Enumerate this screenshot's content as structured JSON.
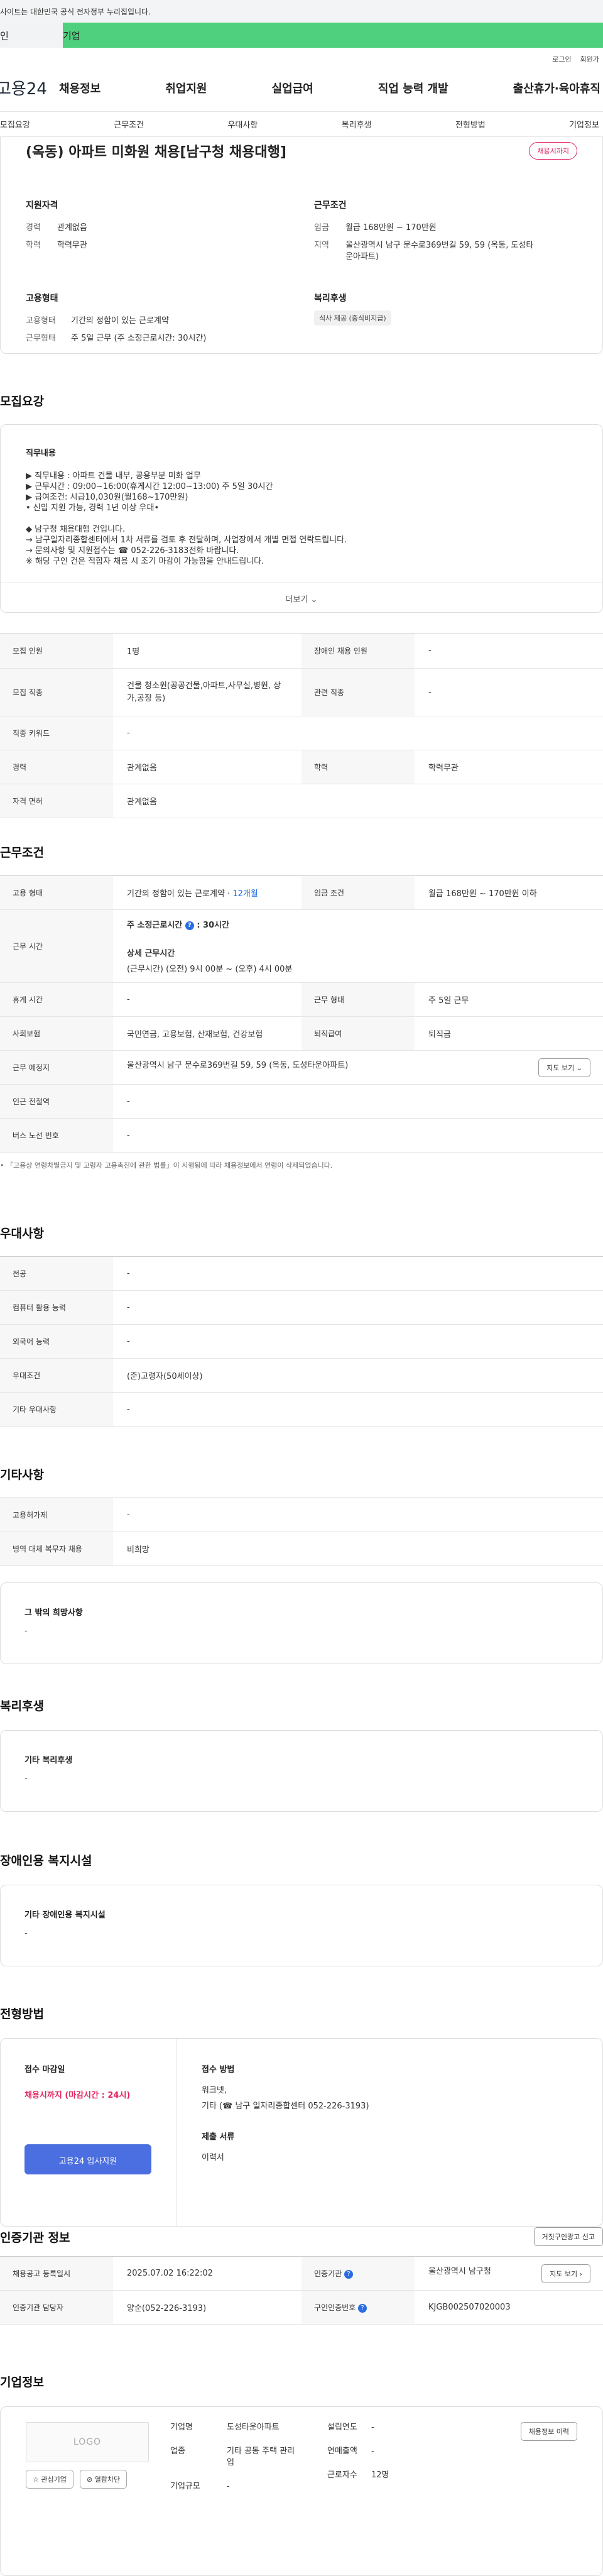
{
  "banner": {
    "text": "사이트는 대한민국 공식 전자정부 누리집입니다."
  },
  "tabs": {
    "personal": "인",
    "company": "기업"
  },
  "util": {
    "login": "로그인",
    "signup": "회원가"
  },
  "gnb": {
    "logo": "고용24",
    "items": [
      "채용정보",
      "취업지원",
      "실업급여",
      "직업 능력 개발",
      "출산휴가·육아휴직"
    ]
  },
  "subnav": {
    "items": [
      "모집요강",
      "근무조건",
      "우대사항",
      "복리후생",
      "전형방법",
      "기업정보"
    ]
  },
  "job": {
    "title": "(옥동) 아파트 미화원 채용[남구청 채용대행]",
    "badge": "채용시까지"
  },
  "summary": {
    "qual": {
      "title": "지원자격",
      "rows": [
        {
          "k": "경력",
          "v": "관계없음"
        },
        {
          "k": "학력",
          "v": "학력무관"
        }
      ]
    },
    "cond": {
      "title": "근무조건",
      "rows": [
        {
          "k": "임금",
          "v": "월급 168만원 ~ 170만원"
        },
        {
          "k": "지역",
          "v": "울산광역시 남구 문수로369번길 59, 59 (옥동, 도성타운아파트)"
        }
      ]
    },
    "emp": {
      "title": "고용형태",
      "rows": [
        {
          "k": "고용형태",
          "v": "기간의 정함이 있는 근로계약"
        },
        {
          "k": "근무형태",
          "v": "주 5일 근무 (주 소정근로시간: 30시간)"
        }
      ]
    },
    "welfare": {
      "title": "복리후생",
      "chip": "식사 제공 (중식비지급)"
    }
  },
  "recruit": {
    "section": "모집요강",
    "detail_heading": "직무내용",
    "detail_lines": [
      "▶ 직무내용 : 아파트 건물 내부, 공용부분 미화 업무",
      "▶ 근무시간 : 09:00~16:00(휴게시간 12:00~13:00) 주 5일 30시간",
      "▶ 급여조건: 시급10,030원(월168~170만원)",
      "• 신입 지원 가능, 경력 1년 이상 우대•",
      "",
      "◆ 남구청 채용대행 건입니다.",
      "→ 남구일자리종합센터에서 1차 서류를 검토 후 전달하며, 사업장에서 개별 면접 연락드립니다.",
      "→ 문의사항 및 지원접수는 ☎ 052-226-3183전화 바랍니다.",
      "※ 해당 구인 건은 적합자 채용 시 조기 마감이 가능함을 안내드립니다."
    ],
    "more": "더보기 ⌄",
    "rows": [
      {
        "k1": "모집 인원",
        "v1": "1명",
        "k2": "장애인 채용 인원",
        "v2": "-"
      },
      {
        "k1": "모집 직종",
        "v1": "건물 청소원(공공건물,아파트,사무실,병원, 상가,공장 등)",
        "k2": "관련 직종",
        "v2": "-"
      },
      {
        "k1": "직종 키워드",
        "v1": "-"
      },
      {
        "k1": "경력",
        "v1": "관계없음",
        "k2": "학력",
        "v2": "학력무관"
      },
      {
        "k1": "자격 면허",
        "v1": "관계없음"
      }
    ]
  },
  "conditions": {
    "section": "근무조건",
    "emp_type_k": "고용 형태",
    "emp_type_v": "기간의 정함이 있는 근로계약 · ",
    "emp_type_months": "12개월",
    "wage_k": "임금 조건",
    "wage_v": "월급 168만원 ~ 170만원 이하",
    "hours_k": "근무 시간",
    "hours_title": "주 소정근로시간",
    "hours_value": ": 30시간",
    "hours_detail_title": "상세 근무시간",
    "hours_detail": "(근무시간) (오전) 9시 00분 ~ (오후) 4시 00분",
    "break_k": "휴게 시간",
    "break_v": "-",
    "worktype_k": "근무 형태",
    "worktype_v": "주 5일 근무",
    "insurance_k": "사회보험",
    "insurance_v": "국민연금, 고용보험, 산재보험, 건강보험",
    "retire_k": "퇴직급여",
    "retire_v": "퇴직금",
    "place_k": "근무 예정지",
    "place_v": "울산광역시 남구 문수로369번길 59, 59 (옥동, 도성타운아파트)",
    "map_btn": "지도 보기 ⌄",
    "subway_k": "인근 전철역",
    "subway_v": "-",
    "bus_k": "버스 노선 번호",
    "bus_v": "-",
    "note": "• 「고용상 연령차별금지 및 고령자 고용촉진에 관한 법률」이 시행됨에 따라 채용정보에서 연령이 삭제되었습니다."
  },
  "prefer": {
    "section": "우대사항",
    "rows": [
      {
        "k": "전공",
        "v": "-"
      },
      {
        "k": "컴퓨터 활용 능력",
        "v": "-"
      },
      {
        "k": "외국어 능력",
        "v": "-"
      },
      {
        "k": "우대조건",
        "v": "(준)고령자(50세이상)"
      },
      {
        "k": "기타 우대사항",
        "v": "-"
      }
    ]
  },
  "other": {
    "section": "기타사항",
    "rows": [
      {
        "k": "고용허가제",
        "v": "-"
      },
      {
        "k": "병역 대체 복무자 채용",
        "v": "비희망"
      }
    ],
    "wish_title": "그 밖의 희망사항",
    "wish_v": "-"
  },
  "benefits": {
    "section": "복리후생",
    "title": "기타 복리후생",
    "v": "-"
  },
  "disability": {
    "section": "장애인용 복지시설",
    "title": "기타 장애인용 복지시설",
    "v": "-"
  },
  "apply": {
    "section": "전형방법",
    "deadline_title": "접수 마감일",
    "deadline_v": "채용시까지 (마감시간 : 24시)",
    "apply_btn": "고용24 입사지원",
    "method_title": "접수 방법",
    "method_l1": "워크넷,",
    "method_l2": "기타 (☎ 남구 일자리종합센터 052-226-3193)",
    "docs_title": "제출 서류",
    "docs_v": "이력서"
  },
  "cert": {
    "section": "인증기관 정보",
    "report_btn": "거짓구인광고 신고",
    "reg_k": "채용공고 등록일시",
    "reg_v": "2025.07.02 16:22:02",
    "org_k": "인증기관",
    "org_v": "울산광역시 남구청",
    "map_btn": "지도 보기 ›",
    "manager_k": "인증기관 담당자",
    "manager_v": "양순(052-226-3193)",
    "id_k": "구인인증번호",
    "id_v": "KJGB002507020003"
  },
  "company": {
    "section": "기업정보",
    "logo": "LOGO",
    "fav_btn": "관심기업",
    "block_btn": "열람차단",
    "name_k": "기업명",
    "name_v": "도성타운아파트",
    "found_k": "설립연도",
    "found_v": "-",
    "history_btn": "채용정보 이력",
    "industry_k": "업종",
    "industry_v": "기타 공동 주택 관리업",
    "sales_k": "연매출액",
    "sales_v": "-",
    "size_k": "기업규모",
    "size_v": "-",
    "emp_k": "근로자수",
    "emp_v": "12명"
  }
}
